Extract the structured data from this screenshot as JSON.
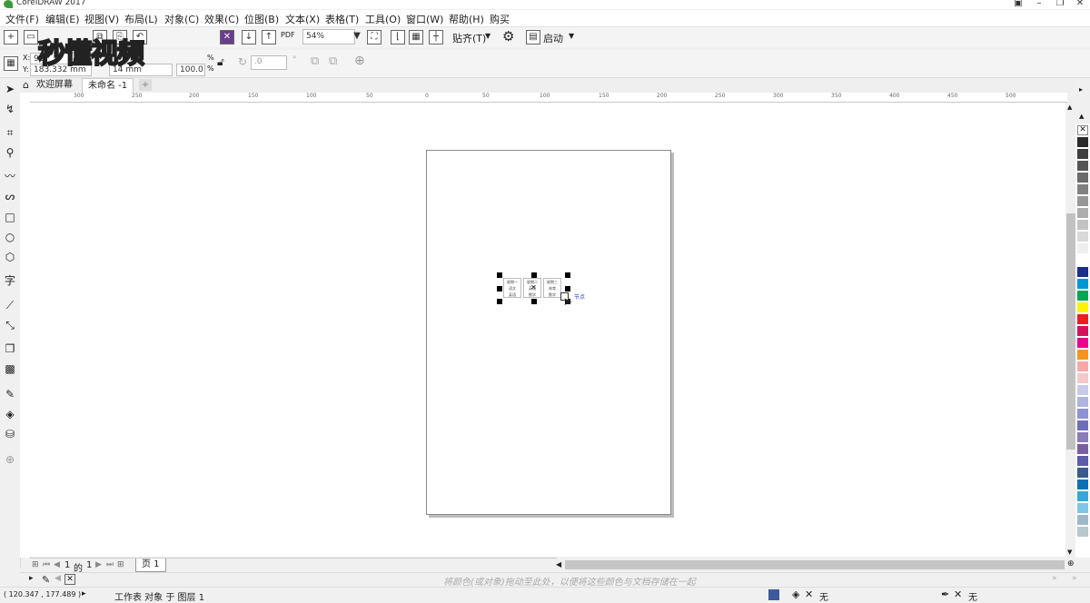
{
  "window": {
    "title": "CorelDRAW 2017"
  },
  "menu": [
    "文件(F)",
    "编辑(E)",
    "视图(V)",
    "布局(L)",
    "对象(C)",
    "效果(C)",
    "位图(B)",
    "文本(X)",
    "表格(T)",
    "工具(O)",
    "窗口(W)",
    "帮助(H)",
    "购买"
  ],
  "toolbar": {
    "zoom": "54%",
    "snap_label": "贴齐(T)",
    "launch_label": "启动",
    "pdf_label": "PDF"
  },
  "props": {
    "x_label": "X:",
    "x_value": "92",
    "y_label": "Y:",
    "y_value": "183.332 mm",
    "w_value": "14 mm",
    "scale_value": "100.0",
    "pct": "%",
    "rotation": ".0"
  },
  "tabs": [
    {
      "label": "欢迎屏幕"
    },
    {
      "label": "未命名 -1"
    }
  ],
  "ruler_h": [
    "300",
    "250",
    "200",
    "150",
    "100",
    "50",
    "0",
    "50",
    "100",
    "150",
    "200",
    "250",
    "300",
    "350",
    "400",
    "450",
    "500"
  ],
  "table": {
    "col1": [
      "星期一",
      "语文",
      "英语"
    ],
    "col2": [
      "星期二",
      "英语",
      "数学"
    ],
    "col3": [
      "星期三",
      "体育",
      "数学"
    ],
    "cursor_label": "节点"
  },
  "pagenav": {
    "current": "1",
    "of": "的",
    "total": "1",
    "page_tab": "页 1"
  },
  "docpalette_hint": "将颜色(或对象)拖动至此处，以便将这些颜色与文档存储在一起",
  "status": {
    "coords": "( 120.347 , 177.489 )",
    "layer": "工作表 对象 于 图层 1",
    "fill_none": "无",
    "outline_none": "无"
  },
  "palette_colors": [
    "#2b2b2b",
    "#3d3d3d",
    "#555555",
    "#6b6b6b",
    "#818181",
    "#979797",
    "#adadad",
    "#c3c3c3",
    "#d9d9d9",
    "#efefef",
    "#ffffff",
    "#1b2e8a",
    "#0096d6",
    "#00a651",
    "#fff200",
    "#ed1c24",
    "#d4145a",
    "#ec008c",
    "#f7941d",
    "#f9a8a8",
    "#f4c9c9",
    "#c9c9e8",
    "#b0b3de",
    "#8f93d1",
    "#6c6fb8",
    "#8b7bb8",
    "#7a5fa0",
    "#5b5ea6",
    "#3b5b8c",
    "#0b6fb3",
    "#37a7d9",
    "#7fc5e6",
    "#9fb8c9",
    "#b9c7cf"
  ],
  "watermark": "秒懂视频"
}
